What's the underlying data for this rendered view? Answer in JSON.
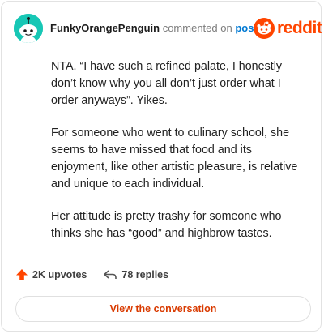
{
  "comment": {
    "username": "FunkyOrangePenguin",
    "action_text": "commented on",
    "post_link": "post",
    "paragraphs": [
      "NTA. “I have such a refined palate, I honestly don’t know why you all don’t just order what I order anyways”. Yikes.",
      "For someone who went to culinary school, she seems to have missed that food and its enjoyment, like other artistic pleasure, is relative and unique to each individual.",
      "Her attitude is pretty trashy for someone who thinks she has “good” and highbrow tastes."
    ]
  },
  "brand": {
    "name": "reddit",
    "color": "#ff4500"
  },
  "stats": {
    "upvotes": "2K upvotes",
    "replies": "78 replies"
  },
  "cta": {
    "label": "View the conversation"
  },
  "icons": {
    "avatar": "snoo-avatar-icon",
    "logo": "reddit-logo-icon",
    "upvote": "upvote-arrow-icon",
    "reply": "reply-arrow-icon"
  },
  "colors": {
    "avatar_bg": "#17c7b5",
    "accent": "#ff4500",
    "link": "#0079d3",
    "cta_text": "#d93a00"
  }
}
